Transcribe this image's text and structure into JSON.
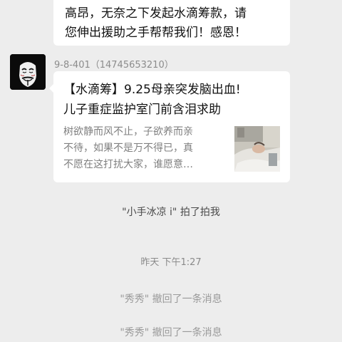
{
  "previous_message": {
    "lines": [
      "高昂，无奈之下发起水滴筹款，请",
      "您伸出援助之手帮帮我们！感恩！"
    ]
  },
  "message": {
    "sender": "9-8-401（14745653210）",
    "avatar_icon": "anonymous-mask-icon",
    "card": {
      "title_lines": [
        "【水滴筹】9.25母亲突发脑出血!",
        "儿子重症监护室门前含泪求助"
      ],
      "desc_lines": [
        "树欲静而风不止，子欲养而亲",
        "不待，如果不是万不得已，真",
        "不愿在这打扰大家，谁愿意…"
      ],
      "thumbnail": "hospital-patient-photo"
    }
  },
  "system": {
    "pat": "\"小手冰凉 i\" 拍了拍我",
    "timestamp": "昨天 下午1:27",
    "recall_1": "\"秀秀\" 撤回了一条消息",
    "recall_2": "\"秀秀\" 撤回了一条消息"
  }
}
